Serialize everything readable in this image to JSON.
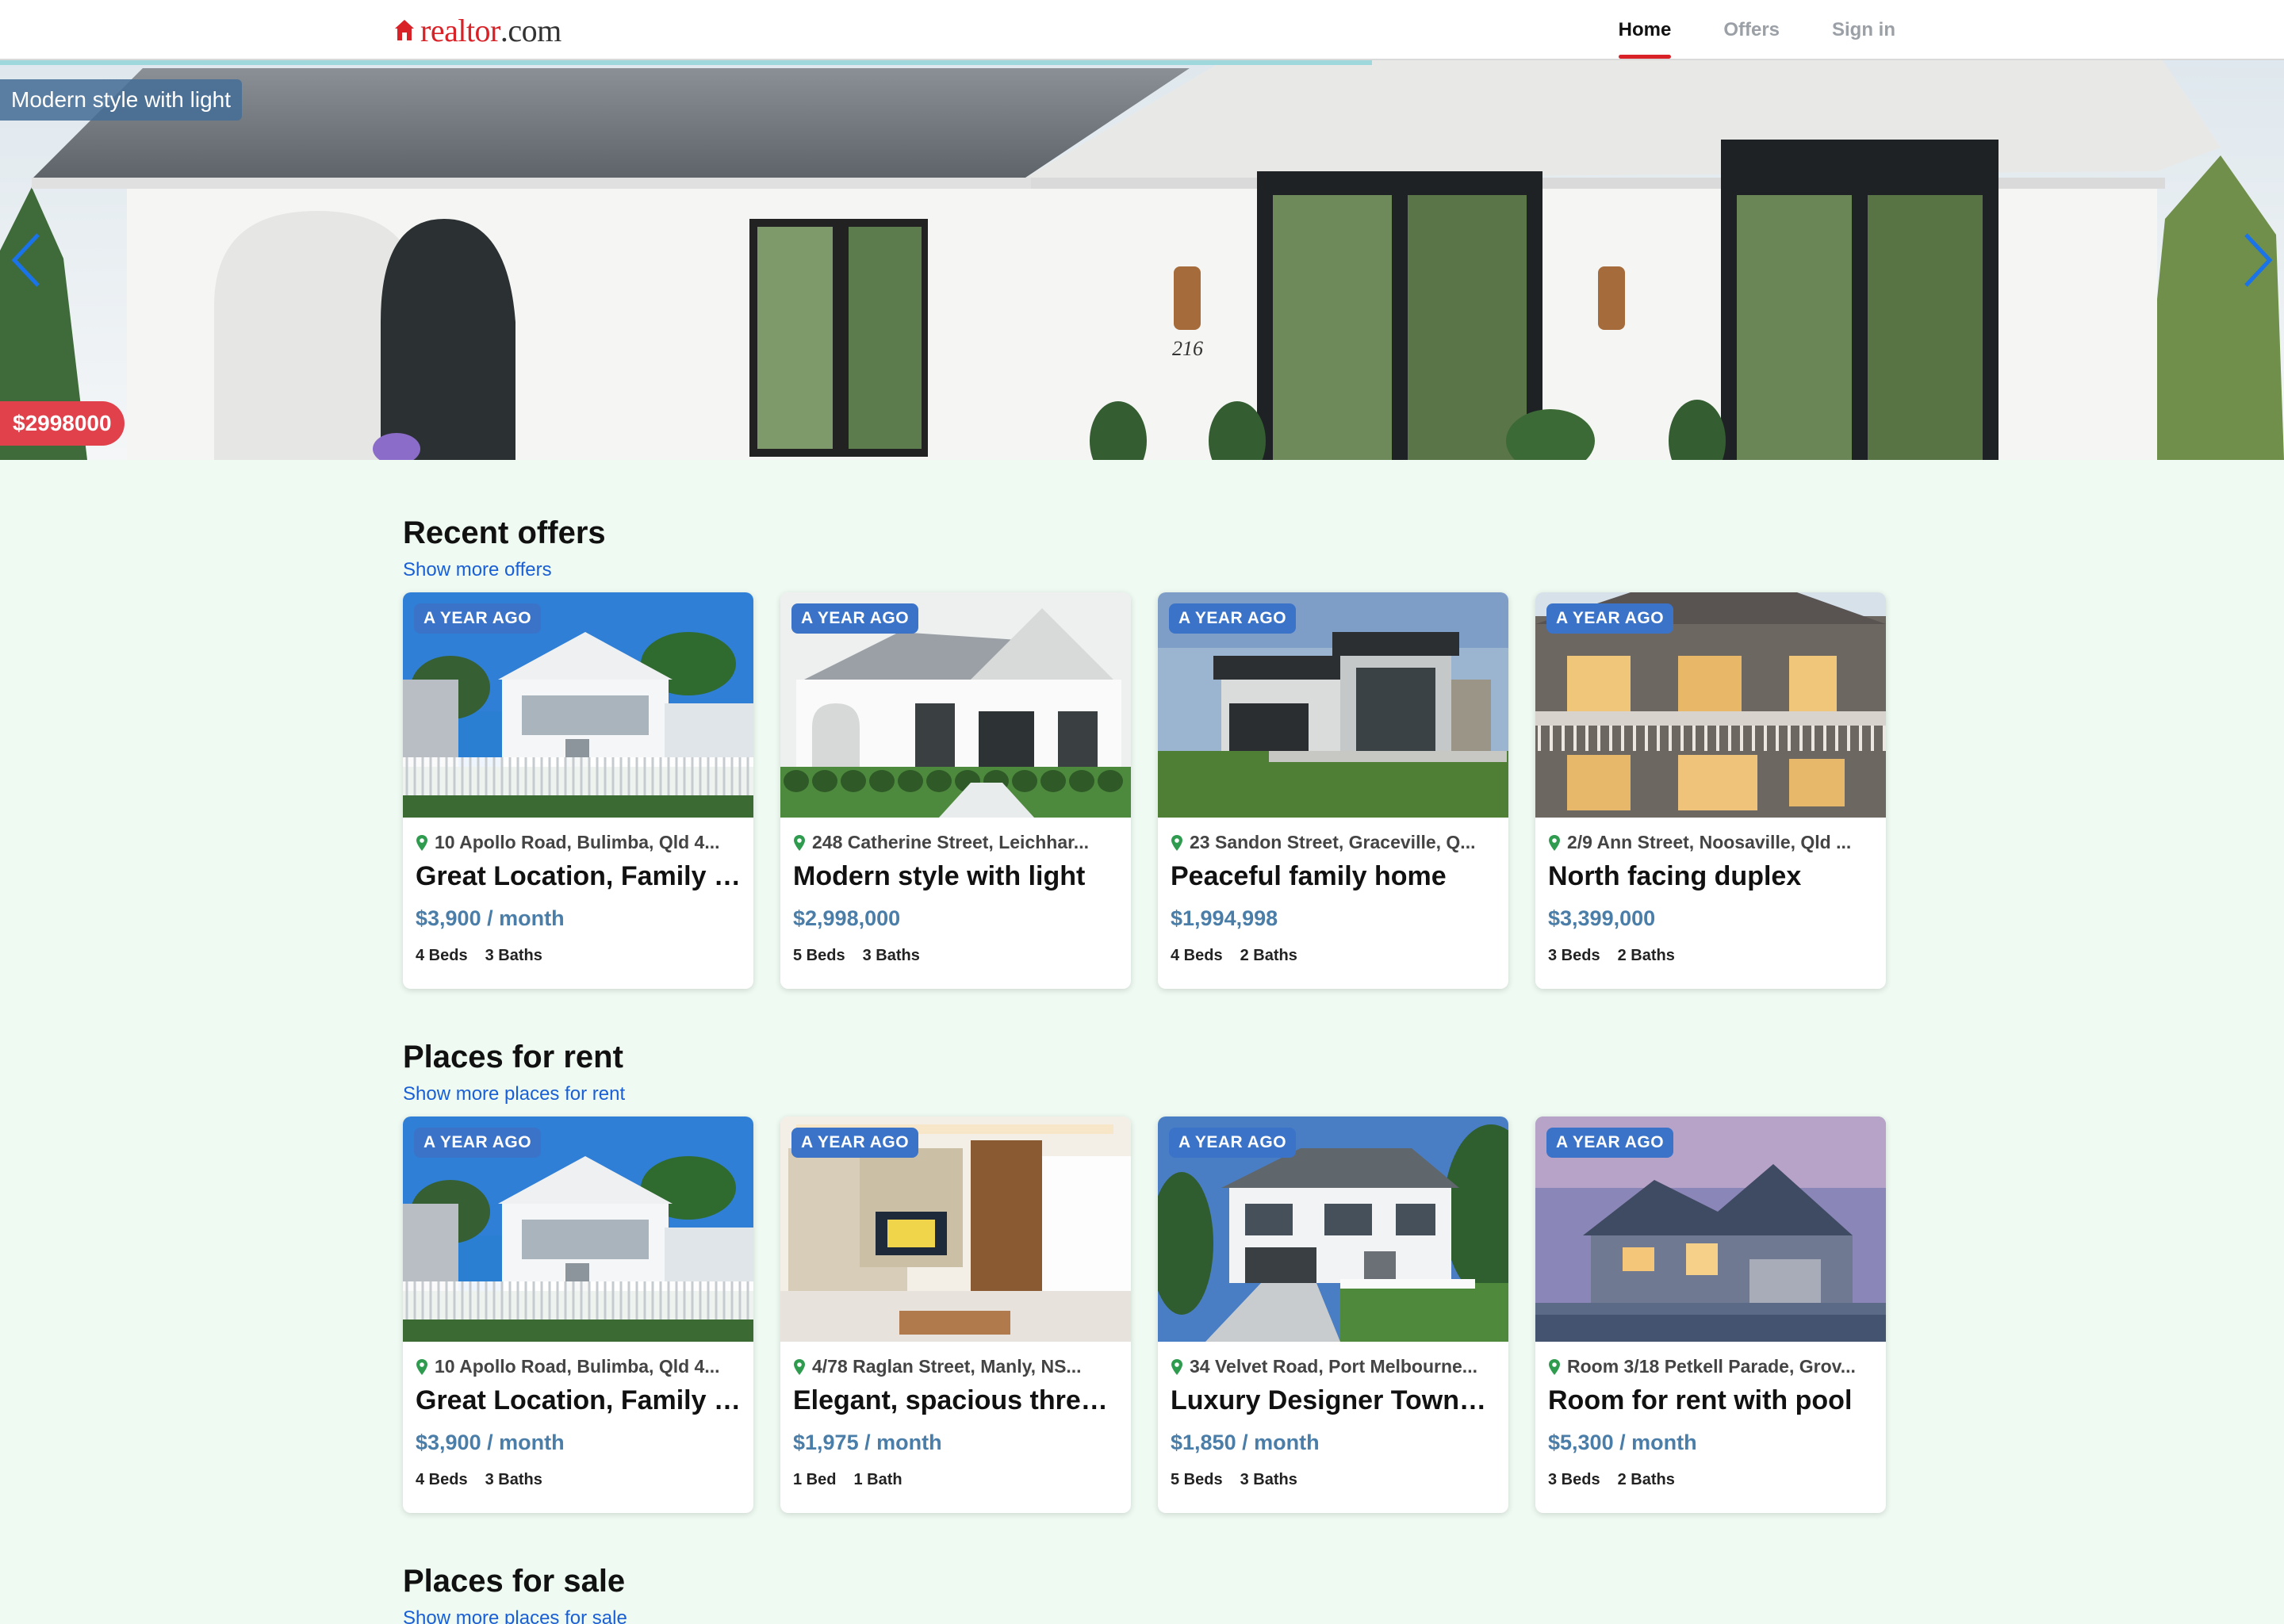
{
  "header": {
    "logo": {
      "name": "realtor",
      "suffix": ".com"
    },
    "nav": [
      {
        "label": "Home",
        "active": true
      },
      {
        "label": "Offers",
        "active": false
      },
      {
        "label": "Sign in",
        "active": false
      }
    ]
  },
  "hero": {
    "caption": "Modern style with light",
    "price": "$2998000",
    "prev_icon": "chevron-left-icon",
    "next_icon": "chevron-right-icon",
    "house_number": "216"
  },
  "sections": [
    {
      "title": "Recent offers",
      "link": "Show more offers",
      "cards": [
        {
          "badge": "A YEAR AGO",
          "address": "10 Apollo Road, Bulimba, Qld 4...",
          "title": "Great Location, Family Fr...",
          "price": "$3,900 / month",
          "beds": "4 Beds",
          "baths": "3 Baths",
          "image": "queenslander-house"
        },
        {
          "badge": "A YEAR AGO",
          "address": "248 Catherine Street, Leichhar...",
          "title": "Modern style with light",
          "price": "$2,998,000",
          "beds": "5 Beds",
          "baths": "3 Baths",
          "image": "white-cottage"
        },
        {
          "badge": "A YEAR AGO",
          "address": "23 Sandon Street, Graceville, Q...",
          "title": "Peaceful family home",
          "price": "$1,994,998",
          "beds": "4 Beds",
          "baths": "2 Baths",
          "image": "modern-stone-house"
        },
        {
          "badge": "A YEAR AGO",
          "address": "2/9 Ann Street, Noosaville, Qld ...",
          "title": "North facing duplex",
          "price": "$3,399,000",
          "beds": "3 Beds",
          "baths": "2 Baths",
          "image": "brick-duplex"
        }
      ]
    },
    {
      "title": "Places for rent",
      "link": "Show more places for rent",
      "cards": [
        {
          "badge": "A YEAR AGO",
          "address": "10 Apollo Road, Bulimba, Qld 4...",
          "title": "Great Location, Family Fr...",
          "price": "$3,900 / month",
          "beds": "4 Beds",
          "baths": "3 Baths",
          "image": "queenslander-house"
        },
        {
          "badge": "A YEAR AGO",
          "address": "4/78 Raglan Street, Manly, NS...",
          "title": "Elegant, spacious three ...",
          "price": "$1,975 / month",
          "beds": "1 Bed",
          "baths": "1 Bath",
          "image": "living-room"
        },
        {
          "badge": "A YEAR AGO",
          "address": "34 Velvet Road, Port Melbourne...",
          "title": "Luxury Designer Townho...",
          "price": "$1,850 / month",
          "beds": "5 Beds",
          "baths": "3 Baths",
          "image": "white-townhouse"
        },
        {
          "badge": "A YEAR AGO",
          "address": "Room 3/18 Petkell Parade, Grov...",
          "title": "Room for rent with pool",
          "price": "$5,300 / month",
          "beds": "3 Beds",
          "baths": "2 Baths",
          "image": "dusk-house"
        }
      ]
    },
    {
      "title": "Places for sale",
      "link": "Show more places for sale",
      "cards": []
    }
  ],
  "colors": {
    "brand_red": "#d92228",
    "page_bg": "#eefaf2",
    "badge_blue": "#3b73c9",
    "price_blue": "#4a7ea8",
    "link_blue": "#1a5fd4",
    "pin_green": "#2e9b4f"
  }
}
